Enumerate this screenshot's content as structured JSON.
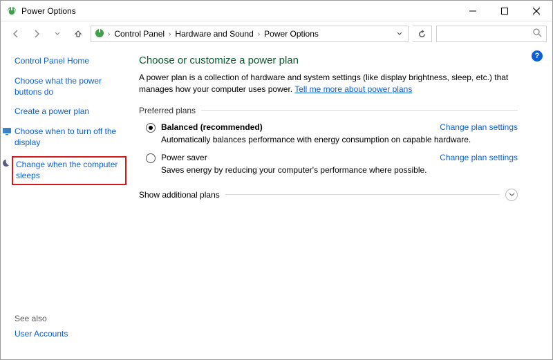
{
  "window": {
    "title": "Power Options"
  },
  "breadcrumb": {
    "items": [
      "Control Panel",
      "Hardware and Sound",
      "Power Options"
    ]
  },
  "sidebar": {
    "home": "Control Panel Home",
    "links": [
      {
        "label": "Choose what the power buttons do",
        "icon": null
      },
      {
        "label": "Create a power plan",
        "icon": null
      },
      {
        "label": "Choose when to turn off the display",
        "icon": "display-timer-icon"
      },
      {
        "label": "Change when the computer sleeps",
        "icon": "moon-icon",
        "highlighted": true
      }
    ],
    "see_also_header": "See also",
    "see_also": [
      "User Accounts"
    ]
  },
  "main": {
    "title": "Choose or customize a power plan",
    "intro_prefix": "A power plan is a collection of hardware and system settings (like display brightness, sleep, etc.) that manages how your computer uses power. ",
    "intro_link": "Tell me more about power plans",
    "preferred_header": "Preferred plans",
    "plans": [
      {
        "name": "Balanced (recommended)",
        "desc": "Automatically balances performance with energy consumption on capable hardware.",
        "selected": true,
        "link": "Change plan settings"
      },
      {
        "name": "Power saver",
        "desc": "Saves energy by reducing your computer's performance where possible.",
        "selected": false,
        "link": "Change plan settings"
      }
    ],
    "show_more": "Show additional plans"
  },
  "help_badge": "?"
}
